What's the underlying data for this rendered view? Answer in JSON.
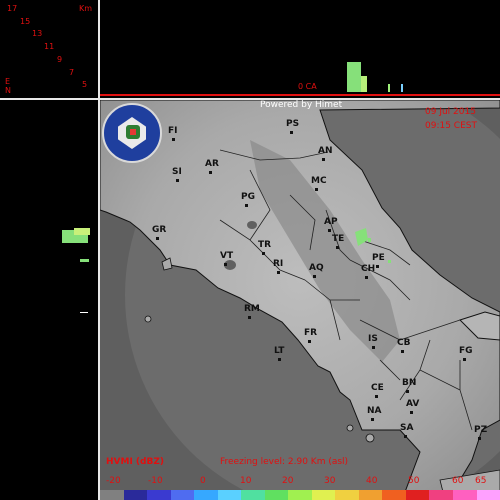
{
  "header": {
    "credit": "Powered by Himet",
    "date": "09 Jul 2015",
    "time": "09:15 CEST"
  },
  "height_scale": {
    "unit": "Km",
    "labels": [
      "17",
      "15",
      "13",
      "11",
      "9",
      "7",
      "5",
      "E",
      "N"
    ]
  },
  "top_panel": {
    "marker_label": "0 CA"
  },
  "legend": {
    "product": "HVMI (dBZ)",
    "freezing": "Freezing level: 2.90 Km (asl)",
    "ticks": [
      "-20",
      "-10",
      "0",
      "10",
      "20",
      "30",
      "40",
      "50",
      "60",
      "65"
    ],
    "colors": [
      "#808080",
      "#2a2a9a",
      "#3a3ad0",
      "#4f6cf0",
      "#36a8ff",
      "#5ad0ff",
      "#50e0a0",
      "#60e060",
      "#a0f050",
      "#e0f050",
      "#f0d040",
      "#f0a030",
      "#f06020",
      "#e02020",
      "#f04080",
      "#ff60c0",
      "#ffa0ff"
    ]
  },
  "cities": [
    {
      "code": "PS"
    },
    {
      "code": "FI"
    },
    {
      "code": "AN"
    },
    {
      "code": "AR"
    },
    {
      "code": "SI"
    },
    {
      "code": "MC"
    },
    {
      "code": "PG"
    },
    {
      "code": "AP"
    },
    {
      "code": "GR"
    },
    {
      "code": "TE"
    },
    {
      "code": "TR"
    },
    {
      "code": "PE"
    },
    {
      "code": "VT"
    },
    {
      "code": "RI"
    },
    {
      "code": "AQ"
    },
    {
      "code": "CH"
    },
    {
      "code": "RM"
    },
    {
      "code": "FR"
    },
    {
      "code": "IS"
    },
    {
      "code": "CB"
    },
    {
      "code": "FG"
    },
    {
      "code": "LT"
    },
    {
      "code": "CE"
    },
    {
      "code": "BN"
    },
    {
      "code": "NA"
    },
    {
      "code": "AV"
    },
    {
      "code": "SA"
    },
    {
      "code": "PZ"
    }
  ],
  "logo": {
    "name": "civil-protection-logo"
  }
}
